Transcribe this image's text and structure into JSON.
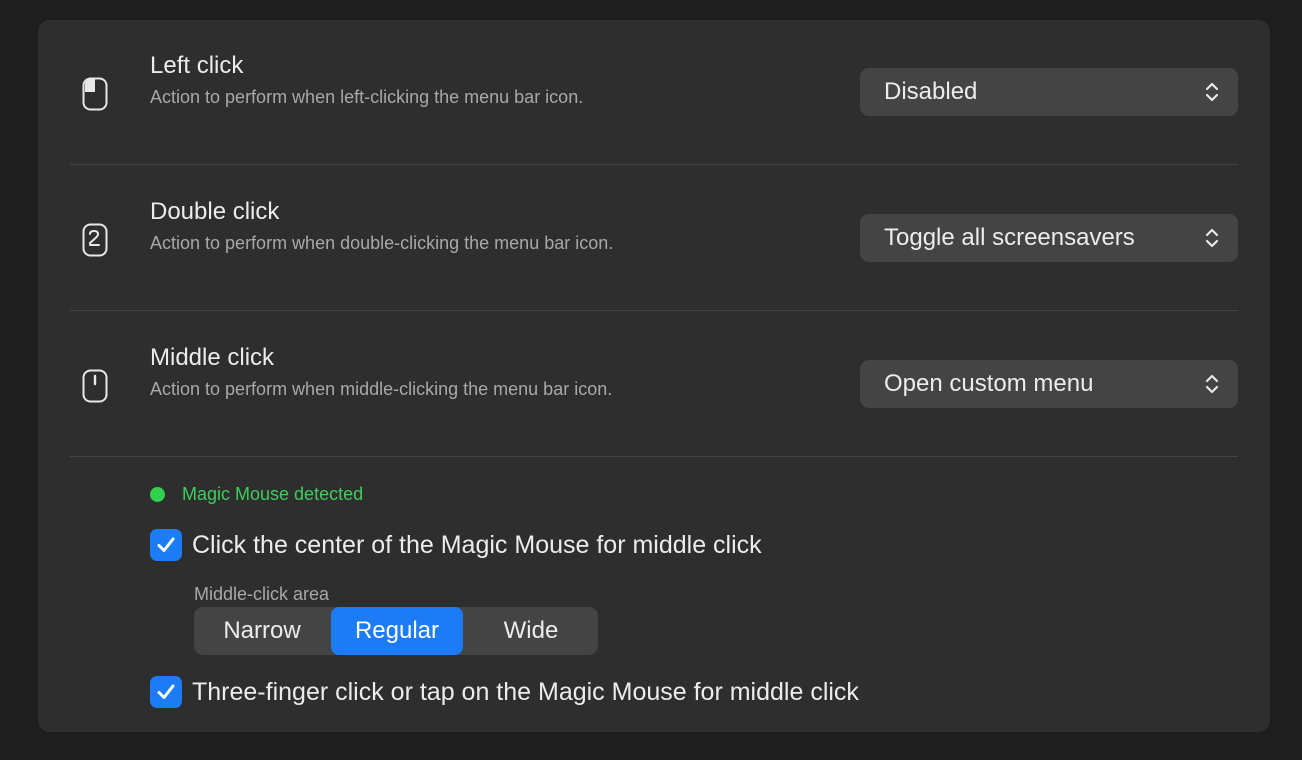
{
  "rows": [
    {
      "title": "Left click",
      "description": "Action to perform when left-clicking the menu bar icon.",
      "icon": "mouse-left-click-icon",
      "selected": "Disabled"
    },
    {
      "title": "Double click",
      "description": "Action to perform when double-clicking the menu bar icon.",
      "icon": "mouse-double-click-icon",
      "selected": "Toggle all screensavers"
    },
    {
      "title": "Middle click",
      "description": "Action to perform when middle-clicking the menu bar icon.",
      "icon": "mouse-middle-click-icon",
      "selected": "Open custom menu"
    }
  ],
  "magic_mouse": {
    "status": "Magic Mouse detected",
    "status_color": "#32d04f",
    "center_click": {
      "label": "Click the center of the Magic Mouse for middle click",
      "checked": true
    },
    "area": {
      "title": "Middle-click area",
      "options": [
        "Narrow",
        "Regular",
        "Wide"
      ],
      "selected": "Regular"
    },
    "three_finger": {
      "label": "Three-finger click or tap on the Magic Mouse for middle click",
      "checked": true
    }
  },
  "colors": {
    "accent": "#1b7cf5",
    "panel": "#2e2e2e",
    "background": "#1e1e1e"
  }
}
